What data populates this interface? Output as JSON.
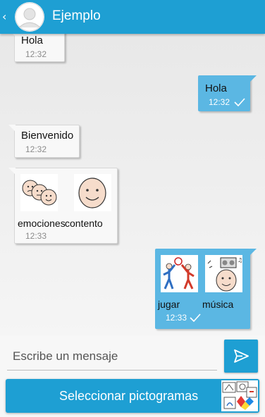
{
  "appbar": {
    "title": "Ejemplo",
    "back_glyph": "‹",
    "avatar_icon": "person-avatar-icon"
  },
  "messages": [
    {
      "direction": "in",
      "text": "Hola",
      "time": "12:32"
    },
    {
      "direction": "out",
      "text": "Hola",
      "time": "12:32",
      "status_icon": "checkmark-icon"
    },
    {
      "direction": "in",
      "text": "Bienvenido",
      "time": "12:32"
    },
    {
      "direction": "in",
      "pictograms": [
        {
          "label": "emociones",
          "icon": "faces-emotions-icon"
        },
        {
          "label": "contento",
          "icon": "happy-face-icon"
        }
      ],
      "time": "12:33"
    },
    {
      "direction": "out",
      "pictograms": [
        {
          "label": "jugar",
          "icon": "children-playing-ball-icon"
        },
        {
          "label": "música",
          "icon": "music-radio-icon"
        }
      ],
      "time": "12:33",
      "status_icon": "checkmark-icon"
    }
  ],
  "composer": {
    "placeholder": "Escribe un mensaje",
    "send_icon": "send-icon",
    "select_label": "Seleccionar pictogramas",
    "select_icon": "pictogram-collage-icon"
  },
  "colors": {
    "primary": "#1e9fd3",
    "outgoing_bubble": "#5bb7e3",
    "incoming_bubble": "#f8f8f8",
    "time_gray": "#8b8b8b"
  }
}
